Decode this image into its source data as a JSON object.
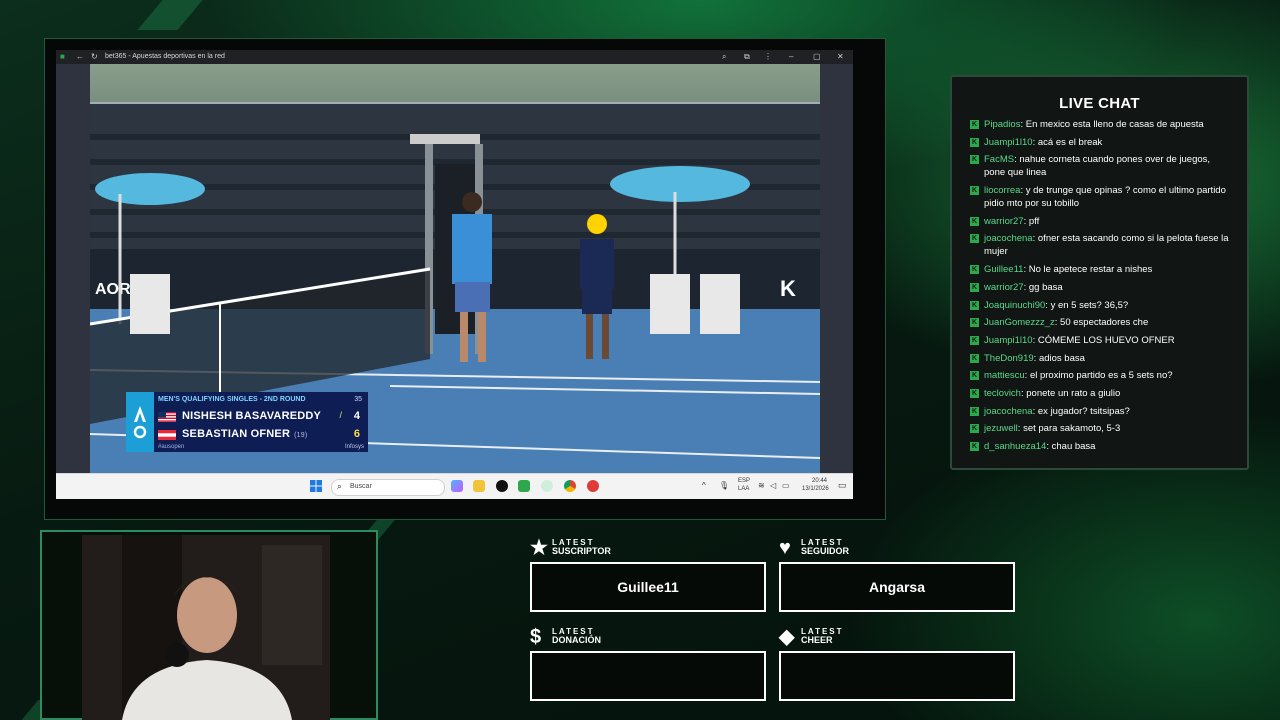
{
  "browser": {
    "tab_title": "bet365 - Apuestas deportivas en la red"
  },
  "scoreboard": {
    "round": "MEN'S QUALIFYING SINGLES - 2ND ROUND",
    "sets_header": "35",
    "players": [
      {
        "name": "NISHESH BASAVAREDDY",
        "seed": "",
        "score": "4"
      },
      {
        "name": "SEBASTIAN OFNER",
        "seed": "(19)",
        "score": "6"
      }
    ],
    "footer": "#ausopen",
    "sponsor": "Infosys"
  },
  "taskbar": {
    "search_placeholder": "Buscar",
    "lang_top": "ESP",
    "lang_bottom": "LAA",
    "time": "20:44",
    "date": "13/1/2026"
  },
  "chat": {
    "title": "LIVE CHAT",
    "messages": [
      {
        "user": "Pipadios",
        "text": "En mexico esta lleno de casas de apuesta"
      },
      {
        "user": "Juampi1l10",
        "text": "acá es el break"
      },
      {
        "user": "FacMS",
        "text": "nahue corneta cuando pones over de juegos, pone que linea"
      },
      {
        "user": "liocorrea",
        "text": "y de trunge que opinas ? como el ultimo partido pidio mto por su tobillo"
      },
      {
        "user": "warrior27",
        "text": "pff"
      },
      {
        "user": "joacochena",
        "text": "ofner esta sacando como si la pelota fuese la mujer"
      },
      {
        "user": "Guillee11",
        "text": "No le apetece restar a nishes"
      },
      {
        "user": "warrior27",
        "text": "gg basa"
      },
      {
        "user": "Joaquinuchi90",
        "text": "y en 5 sets? 36,5?"
      },
      {
        "user": "JuanGomezzz_z",
        "text": "50 espectadores che"
      },
      {
        "user": "Juampi1l10",
        "text": "CÓMEME LOS HUEVO OFNER"
      },
      {
        "user": "TheDon919",
        "text": "adios basa"
      },
      {
        "user": "mattiescu",
        "text": "el proximo partido es a 5 sets no?"
      },
      {
        "user": "teclovich",
        "text": "ponete un rato a giulio"
      },
      {
        "user": "joacochena",
        "text": "ex jugador? tsitsipas?"
      },
      {
        "user": "jezuwell",
        "text": "set para sakamoto, 5-3"
      },
      {
        "user": "d_sanhueza14",
        "text": "chau basa"
      }
    ]
  },
  "latest": {
    "suscriptor": {
      "label_top": "LATEST",
      "label_bottom": "SUSCRIPTOR",
      "value": "Guillee11",
      "icon": "star-icon"
    },
    "seguidor": {
      "label_top": "LATEST",
      "label_bottom": "SEGUIDOR",
      "value": "Angarsa",
      "icon": "heart-icon"
    },
    "donacion": {
      "label_top": "LATEST",
      "label_bottom": "DONACIÓN",
      "value": "",
      "icon": "dollar-icon"
    },
    "cheer": {
      "label_top": "LATEST",
      "label_bottom": "CHEER",
      "value": "",
      "icon": "diamond-icon"
    }
  },
  "colors": {
    "accent_green": "#2fa84d",
    "chat_user": "#59d98a",
    "scoreboard_bg": "#0e1e55",
    "court_blue": "#4a7fb5"
  }
}
